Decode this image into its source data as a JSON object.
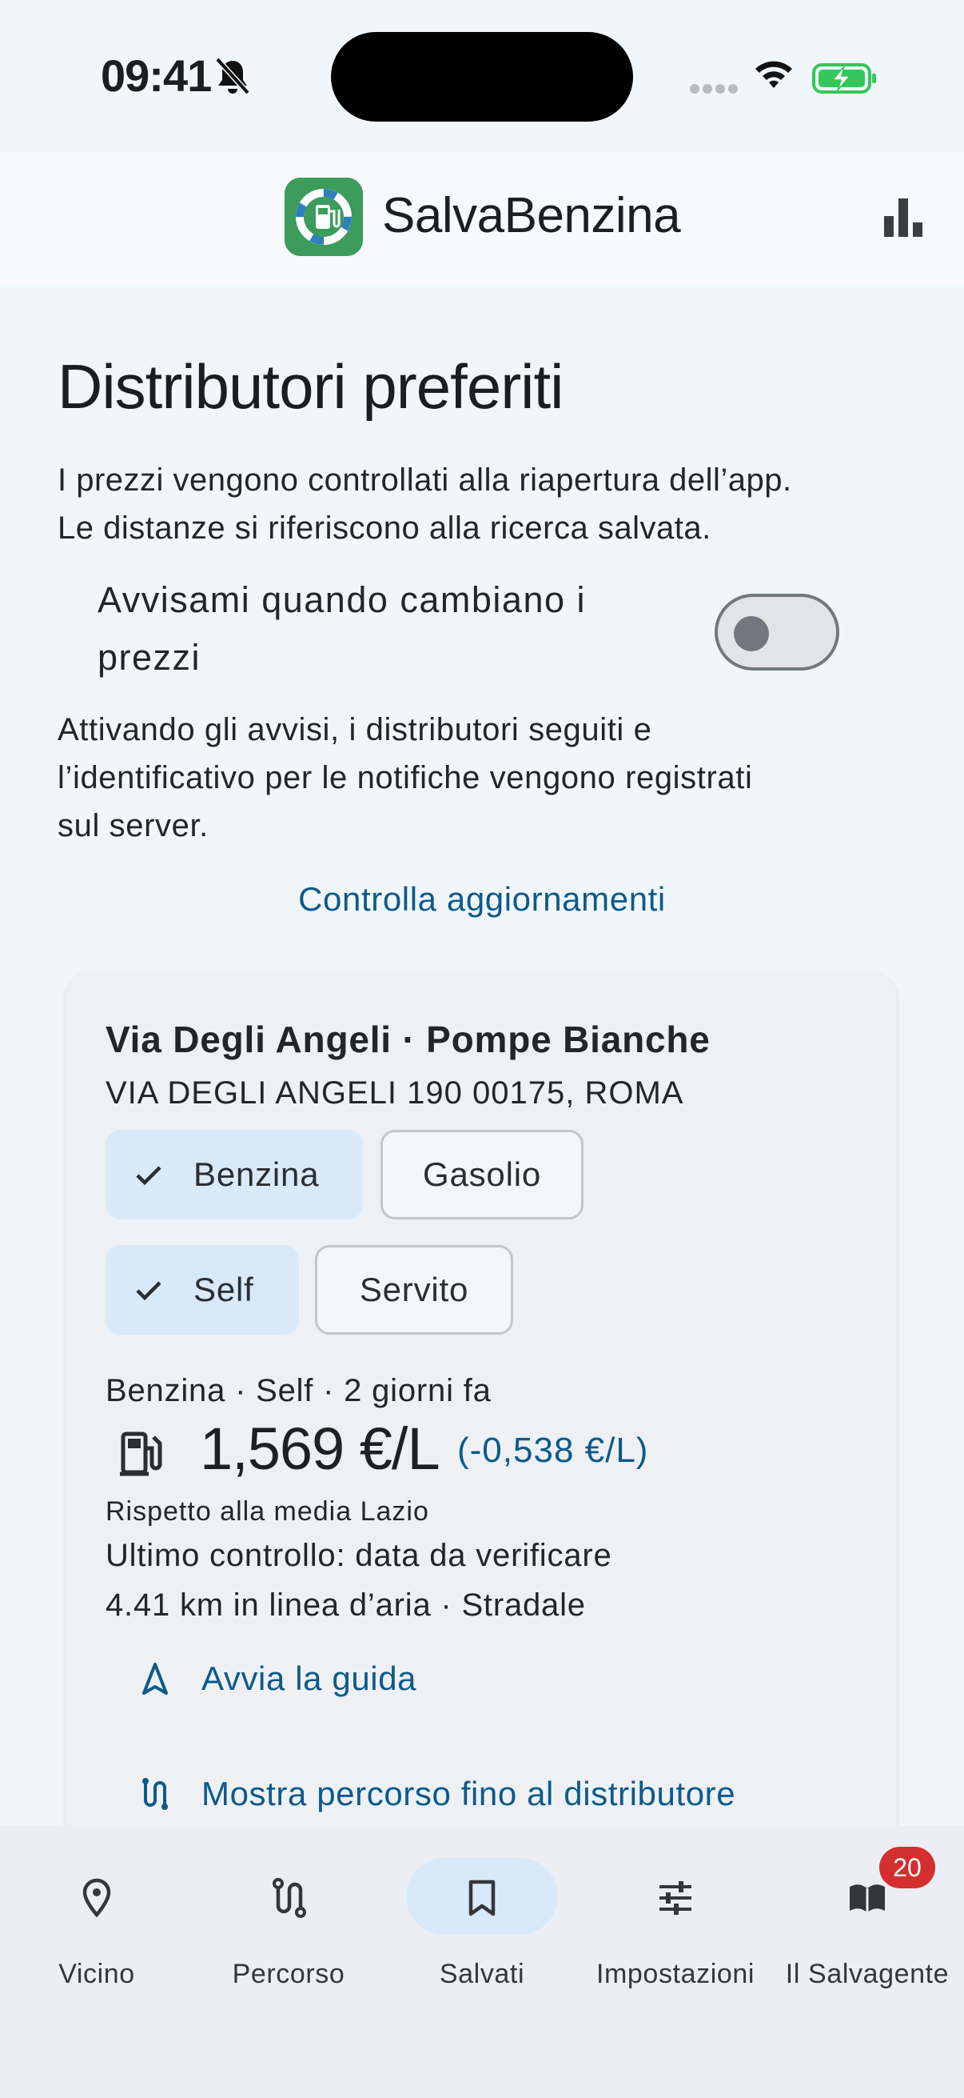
{
  "status_bar": {
    "time": "09:41"
  },
  "header": {
    "app_name": "SalvaBenzina"
  },
  "main": {
    "title": "Distributori preferiti",
    "intro_line_1": "I prezzi vengono controllati alla riapertura dell’app.",
    "intro_line_2": "Le distanze si riferiscono alla ricerca salvata.",
    "alerts_label_line_1": "Avvisami quando cambiano i",
    "alerts_label_line_2": "prezzi",
    "alerts_enabled": false,
    "consent_line_1": "Attivando gli avvisi, i distributori seguiti e",
    "consent_line_2": "l’identificativo per le notifiche vengono registrati",
    "consent_line_3": "sul server.",
    "check_updates_label": "Controlla aggiornamenti"
  },
  "station": {
    "name": "Via Degli Angeli · Pompe Bianche",
    "address": "VIA DEGLI ANGELI 190 00175, ROMA",
    "fuel_chips": [
      {
        "label": "Benzina",
        "selected": true
      },
      {
        "label": "Gasolio",
        "selected": false
      }
    ],
    "service_chips": [
      {
        "label": "Self",
        "selected": true
      },
      {
        "label": "Servito",
        "selected": false
      }
    ],
    "price_meta": "Benzina · Self · 2 giorni fa",
    "price": "1,569 €/L",
    "price_diff": "(-0,538 €/L)",
    "price_note": "Rispetto alla media Lazio",
    "last_check": "Ultimo controllo: data da verificare",
    "distance": "4.41 km in linea d’aria · Stradale",
    "start_nav_label": "Avvia la guida",
    "show_route_label": "Mostra percorso fino al distributore"
  },
  "bottom_nav": {
    "items": [
      {
        "label": "Vicino",
        "icon": "location-pin-icon"
      },
      {
        "label": "Percorso",
        "icon": "route-icon"
      },
      {
        "label": "Salvati",
        "icon": "bookmark-icon",
        "active": true
      },
      {
        "label": "Impostazioni",
        "icon": "sliders-icon"
      },
      {
        "label": "Il Salvagente",
        "icon": "newspaper-icon",
        "badge": "20"
      }
    ]
  },
  "colors": {
    "accent": "#0d5a8a",
    "selected_chip": "#d8eafa",
    "badge": "#d32f2f",
    "logo": "#3d9b5c",
    "battery": "#34c759"
  }
}
